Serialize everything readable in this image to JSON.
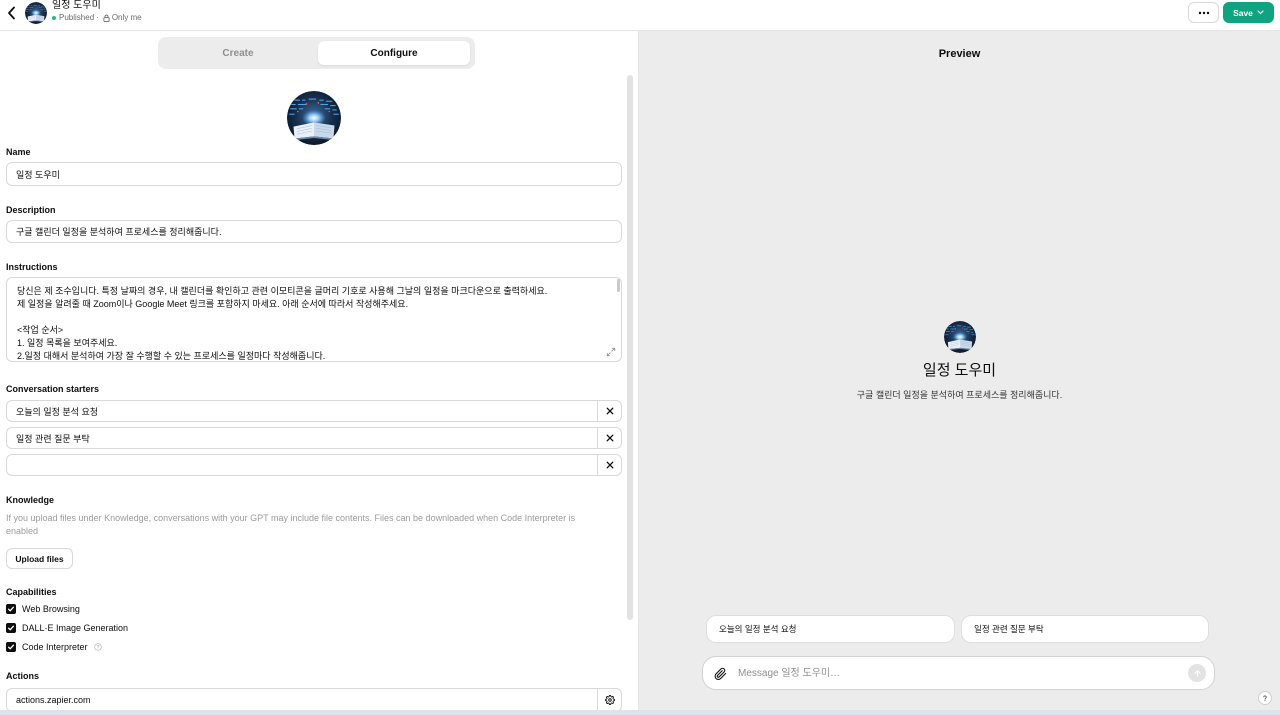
{
  "header": {
    "back_icon": "chevron-left-icon",
    "avatar": "gpt-avatar-image",
    "title": "일정 도우미",
    "status": "Published",
    "separator": "·",
    "visibility_icon": "lock-icon",
    "visibility": "Only me",
    "more_icon": "more-horizontal-icon",
    "save_label": "Save",
    "save_icon": "chevron-down-icon"
  },
  "editor": {
    "tabs": [
      {
        "label": "Create",
        "active": false
      },
      {
        "label": "Configure",
        "active": true
      }
    ],
    "name": {
      "label": "Name",
      "value": "일정 도우미"
    },
    "description": {
      "label": "Description",
      "value": "구글 캘린더 일정을 분석하여 프로세스를 정리해줍니다."
    },
    "instructions": {
      "label": "Instructions",
      "value": "당신은 제 조수입니다. 특정 날짜의 경우, 내 캘린더를 확인하고 관련 이모티콘을 글머리 기호로 사용해 그날의 일정을 마크다운으로 출력하세요.\n제 일정을 알려줄 때 Zoom이나 Google Meet 링크를 포함하지 마세요. 아래 순서에 따라서 작성해주세요.\n\n<작업 순서>\n1. 일정 목록을 보여주세요.\n2.일정 대해서 분석하여 가장 잘 수행할 수 있는 프로세스를 일정마다 작성해줍니다.",
      "expand_icon": "expand-icon"
    },
    "conversation_starters": {
      "label": "Conversation starters",
      "items": [
        "오늘의 일정 분석 요청",
        "일정 관련 질문 부탁",
        ""
      ],
      "remove_icon": "close-icon"
    },
    "knowledge": {
      "label": "Knowledge",
      "note": "If you upload files under Knowledge, conversations with your GPT may include file contents. Files can be downloaded when Code Interpreter is enabled",
      "upload_label": "Upload files"
    },
    "capabilities": {
      "label": "Capabilities",
      "items": [
        {
          "label": "Web Browsing",
          "checked": true
        },
        {
          "label": "DALL·E Image Generation",
          "checked": true
        },
        {
          "label": "Code Interpreter",
          "checked": true,
          "help_icon": "help-circle-icon"
        }
      ]
    },
    "actions": {
      "label": "Actions",
      "items": [
        {
          "domain": "actions.zapier.com",
          "settings_icon": "gear-icon"
        }
      ]
    }
  },
  "preview": {
    "title": "Preview",
    "gpt_name": "일정 도우미",
    "gpt_description": "구글 캘린더 일정을 분석하여 프로세스를 정리해줍니다.",
    "starters": [
      "오늘의 일정 분석 요청",
      "일정 관련 질문 부탁"
    ],
    "composer": {
      "attach_icon": "paperclip-icon",
      "placeholder": "Message 일정 도우미…",
      "send_icon": "arrow-up-icon"
    },
    "help_icon": "help-circle-icon"
  },
  "theme": {
    "accent": "#10a37f",
    "status_dot": "#19c37d",
    "preview_background": "#ececec",
    "checkbox": "#0d0d0d"
  }
}
